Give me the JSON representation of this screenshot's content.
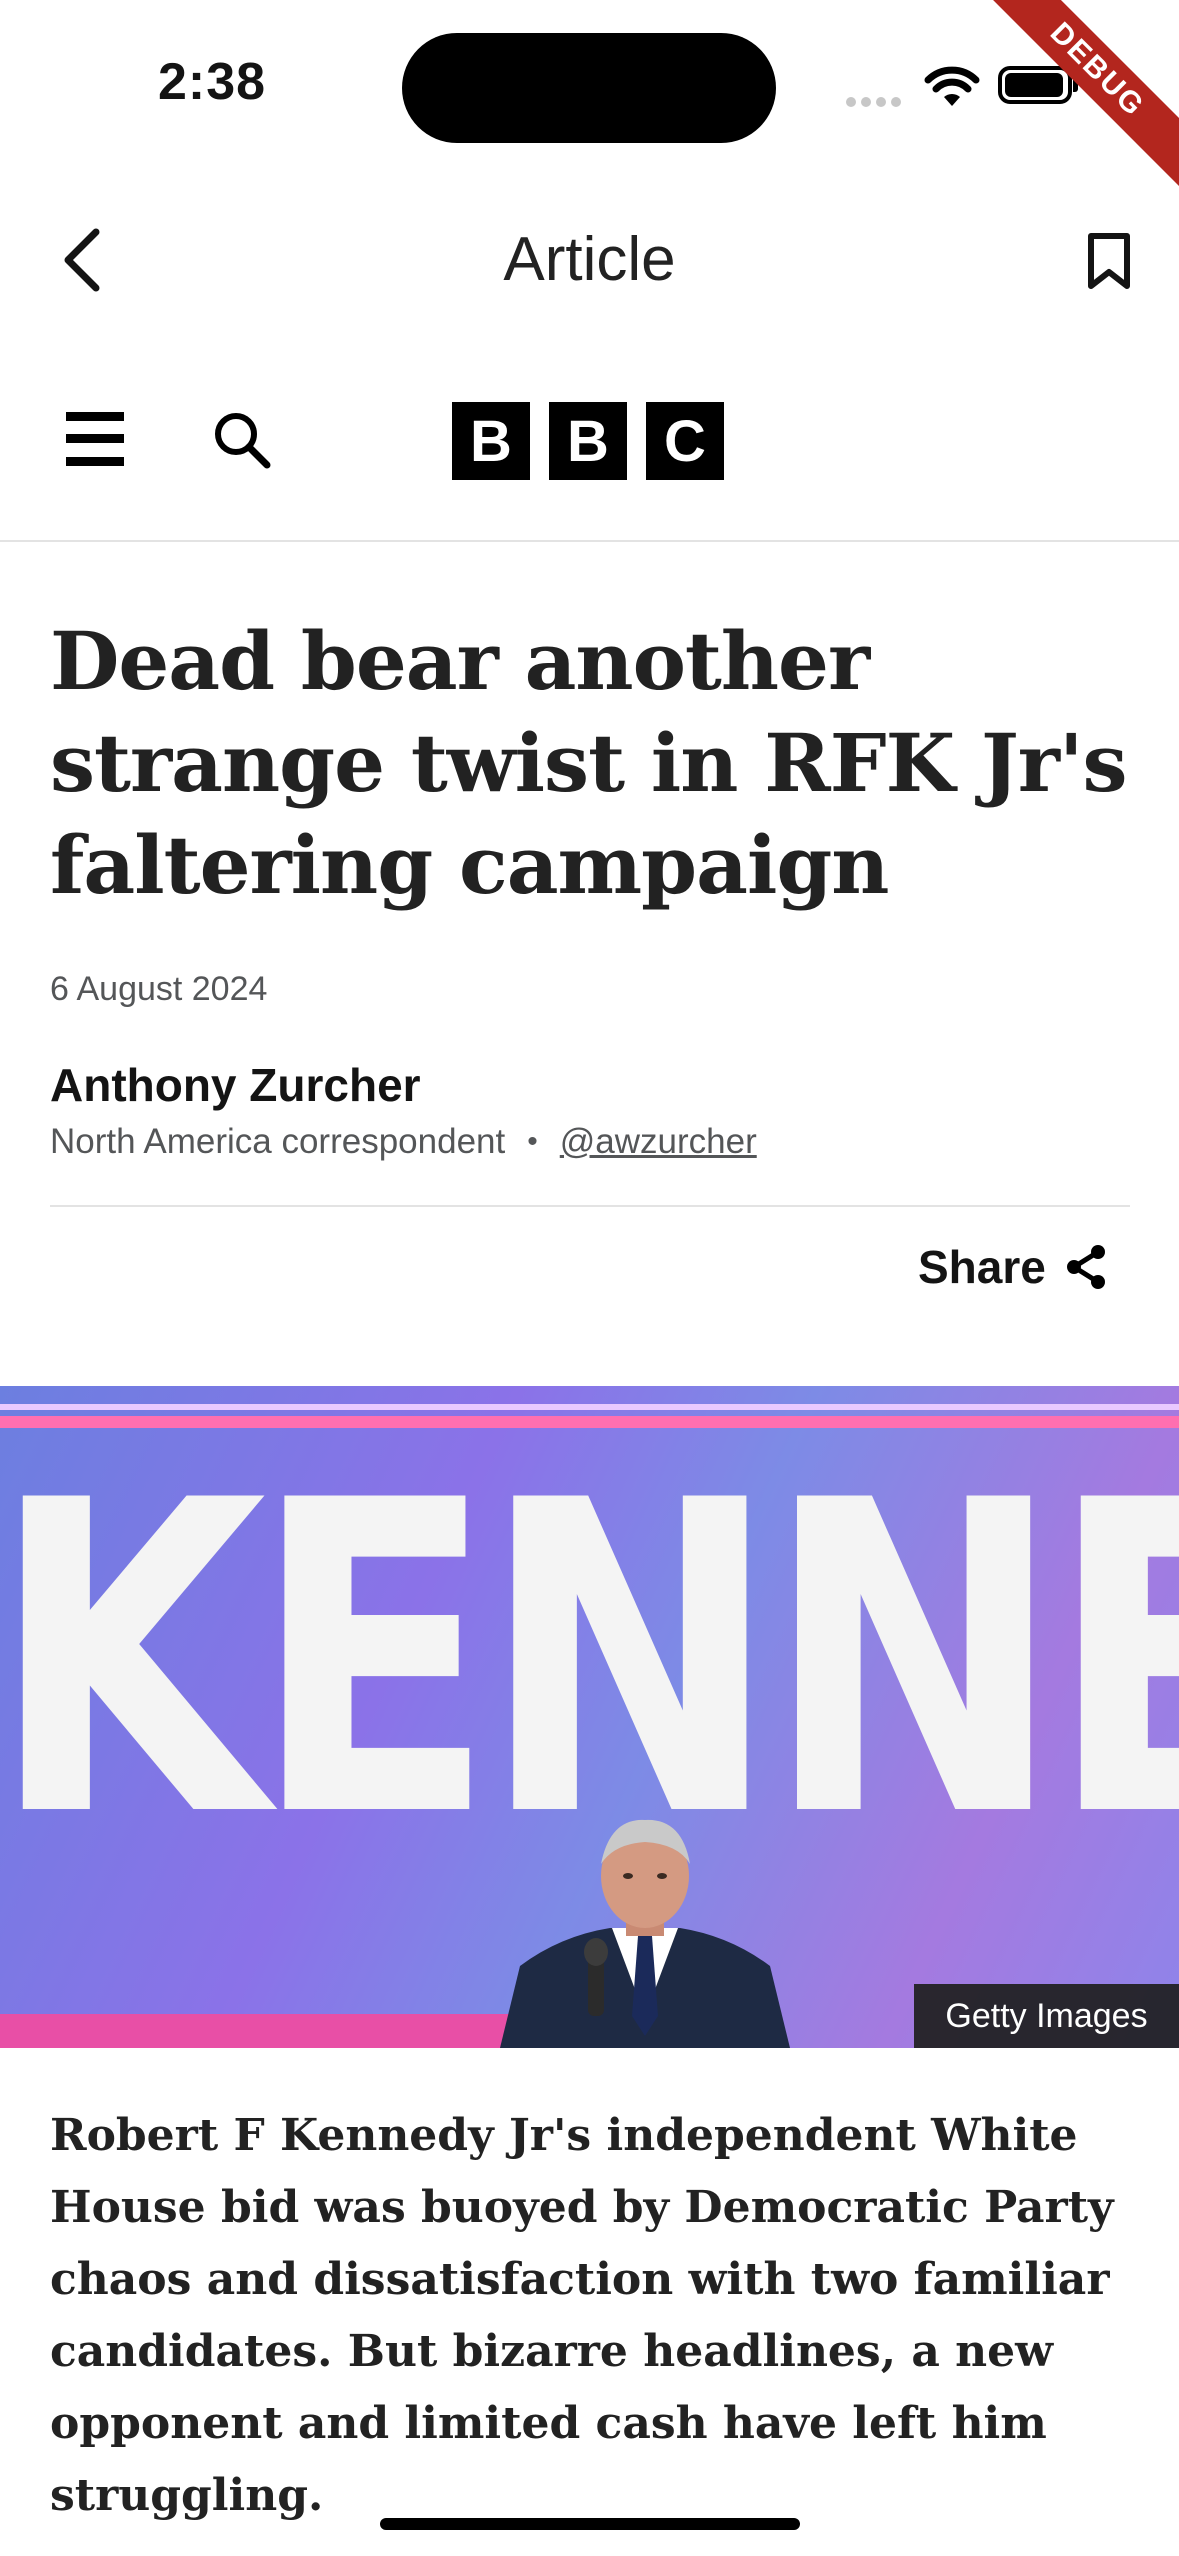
{
  "status_bar": {
    "time": "2:38"
  },
  "debug_banner": "DEBUG",
  "app_bar": {
    "title": "Article"
  },
  "brand": {
    "letters": [
      "B",
      "B",
      "C"
    ]
  },
  "article": {
    "headline": "Dead bear another strange twist in RFK Jr's faltering campaign",
    "date": "6 August 2024",
    "author": "Anthony Zurcher",
    "role": "North America correspondent",
    "separator": "•",
    "handle": "@awzurcher",
    "share_label": "Share",
    "image_text": "KENNEDY",
    "image_credit": "Getty Images",
    "intro": "Robert F Kennedy Jr's independent White House bid was buoyed by Democratic Party chaos and dissatisfaction with two familiar candidates. But bizarre headlines, a new opponent and limited cash have left him struggling."
  },
  "icons": {
    "back": "chevron-left-icon",
    "bookmark": "bookmark-icon",
    "menu": "hamburger-menu-icon",
    "search": "search-icon",
    "share": "share-icon"
  },
  "colors": {
    "debug": "#b3261e",
    "brand": "#000000",
    "meta_text": "#545658"
  }
}
